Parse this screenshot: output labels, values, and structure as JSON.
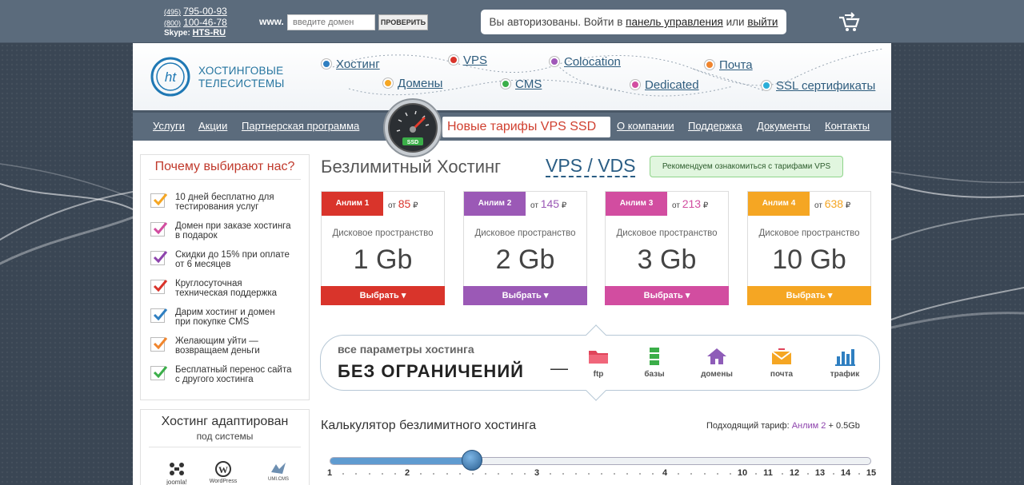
{
  "topbar": {
    "phone1_code": "(495)",
    "phone1": "795-00-93",
    "phone2_code": "(800)",
    "phone2": "100-46-78",
    "skype_label": "Skype:",
    "skype": "HTS-RU",
    "www_label": "www.",
    "domain_placeholder": "введите домен",
    "check_button": "ПРОВЕРИТЬ",
    "auth_prefix": "Вы авторизованы. Войти в",
    "auth_panel_link": "панель управления",
    "auth_or": "или",
    "auth_logout_link": "выйти",
    "cart_icon": "cart-icon"
  },
  "header": {
    "logo_line1": "ХОСТИНГОВЫЕ",
    "logo_line2": "ТЕЛЕСИСТЕМЫ",
    "services": [
      {
        "label": "Хостинг",
        "color": "#2f7fc1"
      },
      {
        "label": "VPS",
        "color": "#d9342b"
      },
      {
        "label": "Colocation",
        "color": "#a057b8"
      },
      {
        "label": "Почта",
        "color": "#f0852d"
      },
      {
        "label": "Домены",
        "color": "#f5a623"
      },
      {
        "label": "CMS",
        "color": "#3bae49"
      },
      {
        "label": "Dedicated",
        "color": "#d24da0"
      },
      {
        "label": "SSL сертификаты",
        "color": "#2aaed8"
      }
    ]
  },
  "nav": {
    "items": [
      "Услуги",
      "Акции",
      "Партнерская программа",
      "О компании",
      "Поддержка",
      "Документы",
      "Контакты"
    ],
    "promo": "Новые тарифы VPS SSD",
    "gauge_label": "SSD"
  },
  "why": {
    "title": "Почему выбирают нас?",
    "items": [
      {
        "line1": "10 дней бесплатно для",
        "line2": "тестирования услуг",
        "color": "#f5a623"
      },
      {
        "line1": "Домен при заказе хостинга",
        "line2": "в подарок",
        "color": "#d24da0"
      },
      {
        "line1": "Скидки до 15% при оплате",
        "line2": "от 6 месяцев",
        "color": "#8e44ad"
      },
      {
        "line1": "Круглосуточная",
        "line2": "техническая поддержка",
        "color": "#d9342b"
      },
      {
        "line1": "Дарим хостинг и домен",
        "line2": "при покупке CMS",
        "color": "#2f7fc1"
      },
      {
        "line1": "Желающим уйти —",
        "line2": "возвращаем деньги",
        "color": "#f0852d"
      },
      {
        "line1": "Бесплатный перенос сайта",
        "line2": "с другого хостинга",
        "color": "#3bae49"
      }
    ]
  },
  "adapt": {
    "title": "Хостинг адаптирован",
    "subtitle": "под системы",
    "logos": [
      "joomla!",
      "WordPress",
      "UMI.CMS"
    ]
  },
  "main": {
    "title": "Безлимитный Хостинг",
    "vps_link": "VPS / VDS",
    "recommend": "Рекомендуем ознакомиться с тарифами VPS"
  },
  "plans": [
    {
      "name": "Анлим 1",
      "price_prefix": "от",
      "price": "85",
      "currency": "₽",
      "disk_label": "Дисковое пространство",
      "disk": "1 Gb",
      "select": "Выбрать ▾",
      "color": "#d9342b"
    },
    {
      "name": "Анлим 2",
      "price_prefix": "от",
      "price": "145",
      "currency": "₽",
      "disk_label": "Дисковое пространство",
      "disk": "2 Gb",
      "select": "Выбрать ▾",
      "color": "#9b59b6"
    },
    {
      "name": "Анлим 3",
      "price_prefix": "от",
      "price": "213",
      "currency": "₽",
      "disk_label": "Дисковое пространство",
      "disk": "3 Gb",
      "select": "Выбрать ▾",
      "color": "#d24da0"
    },
    {
      "name": "Анлим 4",
      "price_prefix": "от",
      "price": "638",
      "currency": "₽",
      "disk_label": "Дисковое пространство",
      "disk": "10 Gb",
      "select": "Выбрать ▾",
      "color": "#f5a623"
    }
  ],
  "params": {
    "line1": "все параметры хостинга",
    "line2": "БЕЗ ОГРАНИЧЕНИЙ",
    "dash": "—",
    "items": [
      {
        "label": "ftp",
        "icon": "folder-icon"
      },
      {
        "label": "базы",
        "icon": "database-icon"
      },
      {
        "label": "домены",
        "icon": "house-icon"
      },
      {
        "label": "почта",
        "icon": "envelope-icon"
      },
      {
        "label": "трафик",
        "icon": "bar-chart-icon"
      }
    ]
  },
  "calculator": {
    "title": "Калькулятор безлимитного хостинга",
    "tariff_label": "Подходящий тариф:",
    "tariff_name": "Анлим 2",
    "tariff_extra": "+ 0.5Gb",
    "value": 2.5,
    "ticks": [
      "1",
      "2",
      "3",
      "4",
      "10",
      "11",
      "12",
      "13",
      "14",
      "15"
    ]
  }
}
